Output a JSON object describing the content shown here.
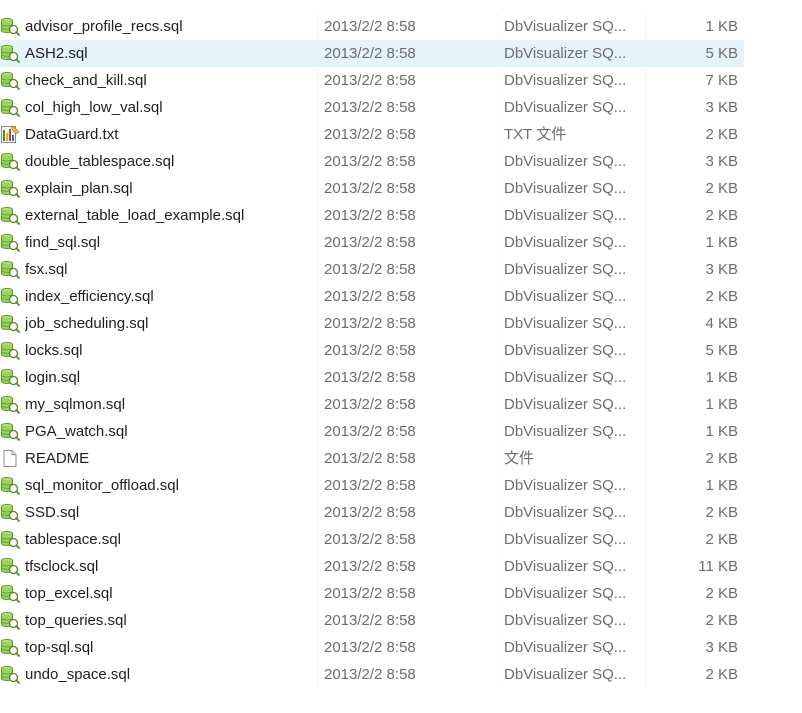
{
  "files": [
    {
      "name": "advisor_profile_recs.sql",
      "modified": "2013/2/2 8:58",
      "type": "DbVisualizer SQ...",
      "size": "1 KB",
      "icon": "sql-file-icon"
    },
    {
      "name": "ASH2.sql",
      "modified": "2013/2/2 8:58",
      "type": "DbVisualizer SQ...",
      "size": "5 KB",
      "icon": "sql-file-icon",
      "hovered": true
    },
    {
      "name": "check_and_kill.sql",
      "modified": "2013/2/2 8:58",
      "type": "DbVisualizer SQ...",
      "size": "7 KB",
      "icon": "sql-file-icon"
    },
    {
      "name": "col_high_low_val.sql",
      "modified": "2013/2/2 8:58",
      "type": "DbVisualizer SQ...",
      "size": "3 KB",
      "icon": "sql-file-icon"
    },
    {
      "name": "DataGuard.txt",
      "modified": "2013/2/2 8:58",
      "type": "TXT 文件",
      "size": "2 KB",
      "icon": "text-file-icon"
    },
    {
      "name": "double_tablespace.sql",
      "modified": "2013/2/2 8:58",
      "type": "DbVisualizer SQ...",
      "size": "3 KB",
      "icon": "sql-file-icon"
    },
    {
      "name": "explain_plan.sql",
      "modified": "2013/2/2 8:58",
      "type": "DbVisualizer SQ...",
      "size": "2 KB",
      "icon": "sql-file-icon"
    },
    {
      "name": "external_table_load_example.sql",
      "modified": "2013/2/2 8:58",
      "type": "DbVisualizer SQ...",
      "size": "2 KB",
      "icon": "sql-file-icon"
    },
    {
      "name": "find_sql.sql",
      "modified": "2013/2/2 8:58",
      "type": "DbVisualizer SQ...",
      "size": "1 KB",
      "icon": "sql-file-icon"
    },
    {
      "name": "fsx.sql",
      "modified": "2013/2/2 8:58",
      "type": "DbVisualizer SQ...",
      "size": "3 KB",
      "icon": "sql-file-icon"
    },
    {
      "name": "index_efficiency.sql",
      "modified": "2013/2/2 8:58",
      "type": "DbVisualizer SQ...",
      "size": "2 KB",
      "icon": "sql-file-icon"
    },
    {
      "name": "job_scheduling.sql",
      "modified": "2013/2/2 8:58",
      "type": "DbVisualizer SQ...",
      "size": "4 KB",
      "icon": "sql-file-icon"
    },
    {
      "name": "locks.sql",
      "modified": "2013/2/2 8:58",
      "type": "DbVisualizer SQ...",
      "size": "5 KB",
      "icon": "sql-file-icon"
    },
    {
      "name": "login.sql",
      "modified": "2013/2/2 8:58",
      "type": "DbVisualizer SQ...",
      "size": "1 KB",
      "icon": "sql-file-icon"
    },
    {
      "name": "my_sqlmon.sql",
      "modified": "2013/2/2 8:58",
      "type": "DbVisualizer SQ...",
      "size": "1 KB",
      "icon": "sql-file-icon"
    },
    {
      "name": "PGA_watch.sql",
      "modified": "2013/2/2 8:58",
      "type": "DbVisualizer SQ...",
      "size": "1 KB",
      "icon": "sql-file-icon"
    },
    {
      "name": "README",
      "modified": "2013/2/2 8:58",
      "type": "文件",
      "size": "2 KB",
      "icon": "blank-file-icon"
    },
    {
      "name": "sql_monitor_offload.sql",
      "modified": "2013/2/2 8:58",
      "type": "DbVisualizer SQ...",
      "size": "1 KB",
      "icon": "sql-file-icon"
    },
    {
      "name": "SSD.sql",
      "modified": "2013/2/2 8:58",
      "type": "DbVisualizer SQ...",
      "size": "2 KB",
      "icon": "sql-file-icon"
    },
    {
      "name": "tablespace.sql",
      "modified": "2013/2/2 8:58",
      "type": "DbVisualizer SQ...",
      "size": "2 KB",
      "icon": "sql-file-icon"
    },
    {
      "name": "tfsclock.sql",
      "modified": "2013/2/2 8:58",
      "type": "DbVisualizer SQ...",
      "size": "11 KB",
      "icon": "sql-file-icon"
    },
    {
      "name": "top_excel.sql",
      "modified": "2013/2/2 8:58",
      "type": "DbVisualizer SQ...",
      "size": "2 KB",
      "icon": "sql-file-icon"
    },
    {
      "name": "top_queries.sql",
      "modified": "2013/2/2 8:58",
      "type": "DbVisualizer SQ...",
      "size": "2 KB",
      "icon": "sql-file-icon"
    },
    {
      "name": "top-sql.sql",
      "modified": "2013/2/2 8:58",
      "type": "DbVisualizer SQ...",
      "size": "3 KB",
      "icon": "sql-file-icon"
    },
    {
      "name": "undo_space.sql",
      "modified": "2013/2/2 8:58",
      "type": "DbVisualizer SQ...",
      "size": "2 KB",
      "icon": "sql-file-icon"
    }
  ],
  "colors": {
    "hover_background": "#e5f3fb",
    "name_text": "#1e1e1e",
    "detail_text": "#6d6d6d",
    "sql_icon_green": "#7cbf3a"
  }
}
